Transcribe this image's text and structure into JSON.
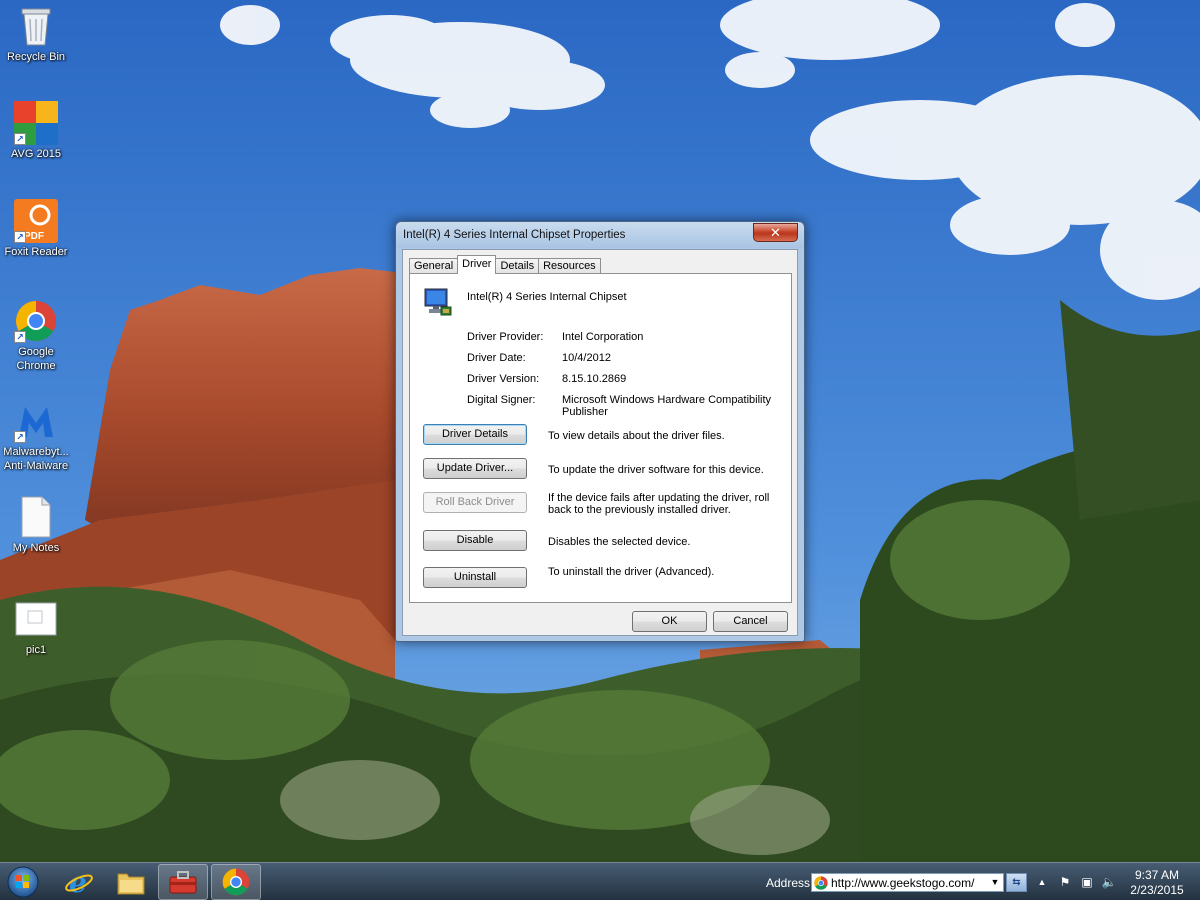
{
  "desktop": {
    "icons": [
      {
        "label": "Recycle Bin",
        "icon": "recycle-bin-icon"
      },
      {
        "label": "AVG 2015",
        "icon": "avg-icon"
      },
      {
        "label": "Foxit Reader",
        "icon": "foxit-reader-icon"
      },
      {
        "label": "Google\nChrome",
        "icon": "chrome-icon"
      },
      {
        "label": "Malwarebyt...\nAnti-Malware",
        "icon": "malwarebytes-icon"
      },
      {
        "label": "My Notes",
        "icon": "text-document-icon"
      },
      {
        "label": "pic1",
        "icon": "image-file-icon"
      }
    ],
    "pdf_badge": "PDF"
  },
  "dialog": {
    "title": "Intel(R) 4 Series Internal Chipset Properties",
    "close_glyph": "✕",
    "tabs": [
      "General",
      "Driver",
      "Details",
      "Resources"
    ],
    "active_tab": "Driver",
    "device_name": "Intel(R) 4 Series Internal Chipset",
    "info": {
      "provider_label": "Driver Provider:",
      "provider_value": "Intel Corporation",
      "date_label": "Driver Date:",
      "date_value": "10/4/2012",
      "version_label": "Driver Version:",
      "version_value": "8.15.10.2869",
      "signer_label": "Digital Signer:",
      "signer_value": "Microsoft Windows Hardware Compatibility Publisher"
    },
    "actions": {
      "driver_details": {
        "label": "Driver Details",
        "desc": "To view details about the driver files."
      },
      "update_driver": {
        "label": "Update Driver...",
        "desc": "To update the driver software for this device."
      },
      "roll_back": {
        "label": "Roll Back Driver",
        "desc": "If the device fails after updating the driver, roll back to the previously installed driver."
      },
      "disable": {
        "label": "Disable",
        "desc": "Disables the selected device."
      },
      "uninstall": {
        "label": "Uninstall",
        "desc": "To uninstall the driver (Advanced)."
      }
    },
    "ok_label": "OK",
    "cancel_label": "Cancel"
  },
  "taskbar": {
    "pinned": [
      "internet-explorer-icon",
      "file-explorer-icon",
      "toolbox-icon",
      "chrome-icon"
    ],
    "address_label": "Address",
    "address_value": "http://www.geekstogo.com/",
    "dropdown_glyph": "▼",
    "go_glyph": "⇆",
    "tray": {
      "up_arrow": "▲",
      "flag": "⚑",
      "network": "▣",
      "volume": "🔈"
    },
    "clock_time": "9:37 AM",
    "clock_date": "2/23/2015"
  }
}
